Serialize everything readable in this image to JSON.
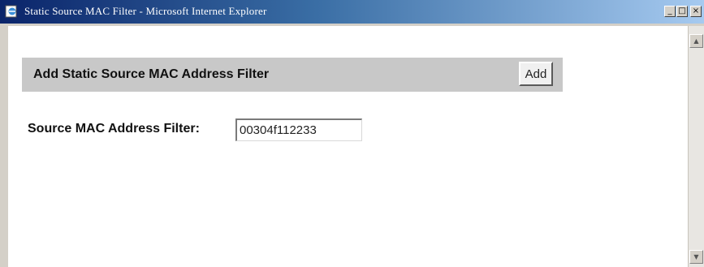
{
  "window": {
    "title": "Static Source MAC Filter - Microsoft Internet Explorer",
    "controls": {
      "minimize": "_",
      "maximize": "□",
      "close": "×"
    }
  },
  "page": {
    "header": "Add Static Source MAC Address Filter",
    "add_button_label": "Add",
    "filter_label": "Source MAC Address Filter:",
    "filter_value": "00304f112233"
  },
  "scrollbar": {
    "up": "▲",
    "down": "▼"
  },
  "icons": {
    "app": "ie-page-icon"
  },
  "colors": {
    "titlebar_start": "#0a246a",
    "titlebar_end": "#a6caf0",
    "header_bar": "#c8c8c8"
  }
}
